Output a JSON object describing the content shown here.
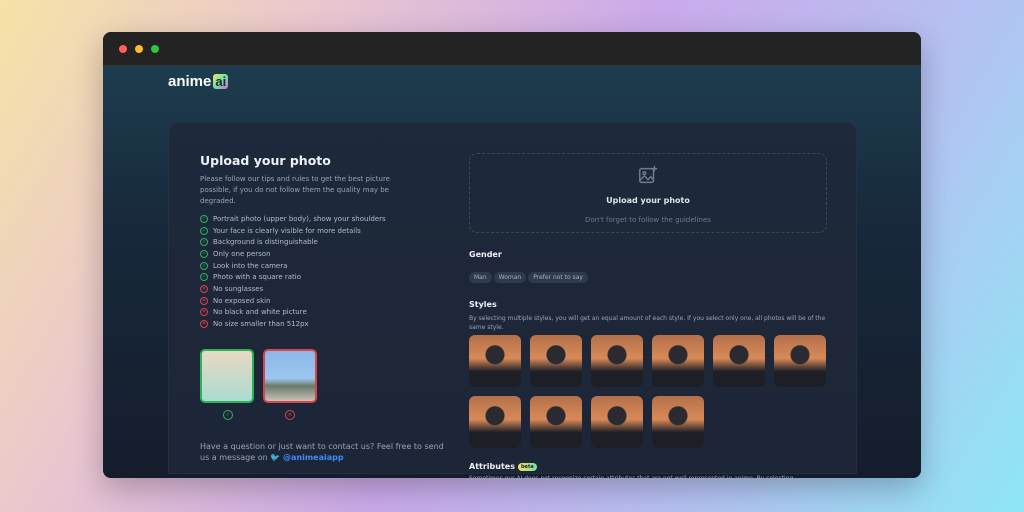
{
  "logo": {
    "text": "anime",
    "badge": "ai"
  },
  "left": {
    "title": "Upload your photo",
    "description": "Please follow our tips and rules to get the best picture possible, if you do not follow them the quality may be degraded.",
    "rules": [
      {
        "text": "Portrait photo (upper body), show your shoulders",
        "ok": true
      },
      {
        "text": "Your face is clearly visible for more details",
        "ok": true
      },
      {
        "text": "Background is distinguishable",
        "ok": true
      },
      {
        "text": "Only one person",
        "ok": true
      },
      {
        "text": "Look into the camera",
        "ok": true
      },
      {
        "text": "Photo with a square ratio",
        "ok": true
      },
      {
        "text": "No sunglasses",
        "ok": false
      },
      {
        "text": "No exposed skin",
        "ok": false
      },
      {
        "text": "No black and white picture",
        "ok": false
      },
      {
        "text": "No size smaller than 512px",
        "ok": false
      }
    ],
    "contact": "Have a question or just want to contact us? Feel free to send us a message on",
    "twitter": "@animeaiapp"
  },
  "upload": {
    "title": "Upload your photo",
    "subtitle": "Don't forget to follow the guidelines"
  },
  "gender": {
    "title": "Gender",
    "options": [
      "Man",
      "Woman",
      "Prefer not to say"
    ]
  },
  "styles": {
    "title": "Styles",
    "description": "By selecting multiple styles, you will get an equal amount of each style. If you select only one, all photos will be of the same style.",
    "count": 10
  },
  "attributes": {
    "title": "Attributes",
    "badge": "beta",
    "description": "Sometimes our AI does not recognize certain attributes that are not well represented in anime. By selecting"
  },
  "colors": {
    "ok": "#2bb35a",
    "bad": "#d9434b",
    "link": "#3d8bfd"
  }
}
